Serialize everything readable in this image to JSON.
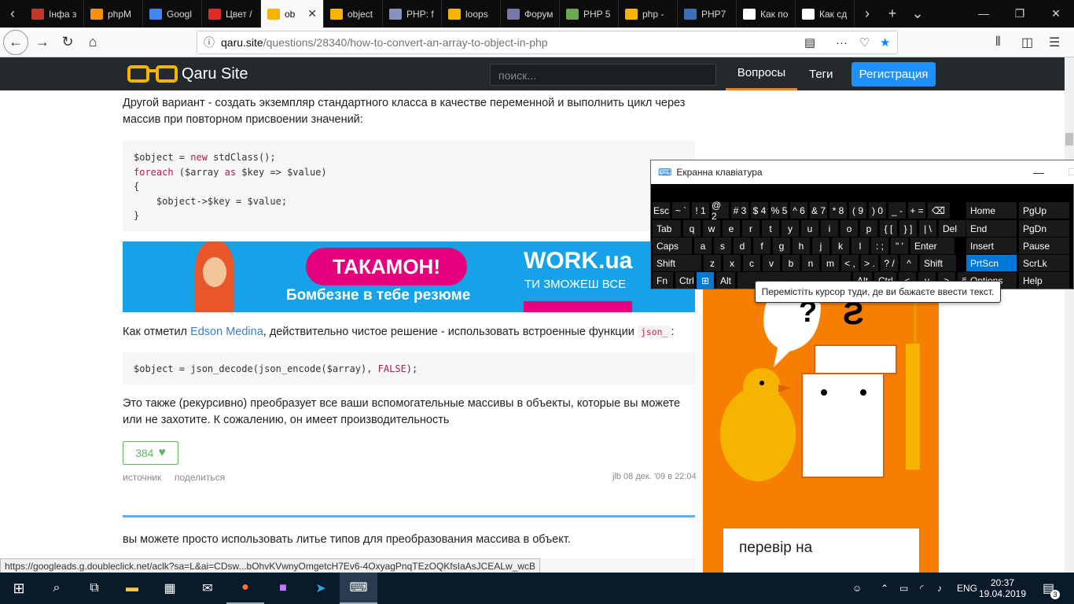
{
  "browser": {
    "tabs": [
      {
        "label": "Інфа з",
        "color": "#c0392b"
      },
      {
        "label": "phpM",
        "color": "#f29111"
      },
      {
        "label": "Googl",
        "color": "#4285f4"
      },
      {
        "label": "Цвет /",
        "color": "#e02b2b"
      },
      {
        "label": "ob",
        "color": "#f4b400",
        "active": true
      },
      {
        "label": "object",
        "color": "#f4b400"
      },
      {
        "label": "PHP: f",
        "color": "#8892bf"
      },
      {
        "label": "loops",
        "color": "#f4b400"
      },
      {
        "label": "Форум",
        "color": "#7777aa"
      },
      {
        "label": "PHP 5",
        "color": "#6aa84f"
      },
      {
        "label": "php -",
        "color": "#f4b400"
      },
      {
        "label": "PHP7",
        "color": "#3b6fb6"
      },
      {
        "label": "Как по",
        "color": "#ffffff"
      },
      {
        "label": "Как сд",
        "color": "#ffffff"
      }
    ],
    "url_host": "qaru.site",
    "url_path": "/questions/28340/how-to-convert-an-array-to-object-in-php",
    "status_url": "https://googleads.g.doubleclick.net/aclk?sa=L&ai=CDsw...bOhvKVwnyOmgetcH7Ev6-4OxyagPnqTEzOQKfsIaAsJCEALw_wcB"
  },
  "site": {
    "logo": "Qaru Site",
    "search_placeholder": "поиск...",
    "nav_questions": "Вопросы",
    "nav_tags": "Теги",
    "nav_register": "Регистрация"
  },
  "answer": {
    "intro": "Другой вариант - создать экземпляр стандартного класса в качестве переменной и выполнить цикл через массив при повторном присвоении значений:",
    "code1": [
      {
        "pre": "$object = ",
        "kw": "new",
        "post": " stdClass();"
      },
      {
        "pre": "",
        "kw": "foreach",
        "post": " ($array ",
        "kw2": "as",
        "post2": " $key => $value)"
      },
      {
        "pre": "{",
        "kw": "",
        "post": ""
      },
      {
        "pre": "    $object->$key = $value;",
        "kw": "",
        "post": ""
      },
      {
        "pre": "}",
        "kw": "",
        "post": ""
      }
    ],
    "note_pre": "Как отметил ",
    "note_link": "Edson Medina",
    "note_post": ", действительно чистое решение - использовать встроенные функции ",
    "note_code": "json_",
    "note_end": ":",
    "code2_pre": "$object = json_decode(json_encode($array), ",
    "code2_kw": "FALSE",
    "code2_post": ");",
    "outro": "Это также (рекурсивно) преобразует все ваши вспомогательные массивы в объекты, которые вы можете или не захотите. К сожалению, он имеет производительность",
    "votes": "384",
    "link_source": "источник",
    "link_share": "поделиться",
    "author_date": "jlb 08 дек. '09 в 22:04",
    "next_answer": "вы можете просто использовать литье типов для преобразования массива в объект."
  },
  "ad_banner": {
    "slogan": "ТАКАМОН!",
    "subtitle": "Бомбезне в тебе резюме",
    "brand": "WORK.ua",
    "brand_sub": "ТИ ЗМОЖЕШ ВСЕ"
  },
  "side_ad": {
    "text": "перевір на"
  },
  "osk": {
    "title": "Екранна клавіатура",
    "tooltip": "Перемістіть курсор туди, де ви бажаєте ввести текст.",
    "row1": [
      "Esc",
      "~ `",
      "! 1",
      "@ 2",
      "# 3",
      "$ 4",
      "% 5",
      "^ 6",
      "& 7",
      "* 8",
      "( 9",
      ") 0",
      "_ -",
      "+ =",
      "⌫"
    ],
    "row2": [
      "Tab",
      "q",
      "w",
      "e",
      "r",
      "t",
      "y",
      "u",
      "i",
      "o",
      "p",
      "{ [",
      "} ]",
      "| \\",
      "Del"
    ],
    "row3": [
      "Caps",
      "a",
      "s",
      "d",
      "f",
      "g",
      "h",
      "j",
      "k",
      "l",
      ": ;",
      "\" '",
      "Enter"
    ],
    "row4": [
      "Shift",
      "z",
      "x",
      "c",
      "v",
      "b",
      "n",
      "m",
      "< ,",
      "> .",
      "? /",
      "^",
      "Shift"
    ],
    "row5": [
      "Fn",
      "Ctrl",
      "⊞",
      "Alt",
      "",
      "Alt",
      "Ctrl",
      "<",
      "v",
      ">",
      "▤"
    ],
    "nav": [
      [
        "Home",
        "PgUp"
      ],
      [
        "End",
        "PgDn"
      ],
      [
        "Insert",
        "Pause"
      ],
      [
        "PrtScn",
        "ScrLk"
      ],
      [
        "Options",
        "Help"
      ]
    ]
  },
  "taskbar": {
    "lang": "ENG",
    "time": "20:37",
    "date": "19.04.2019",
    "notif": "3"
  }
}
